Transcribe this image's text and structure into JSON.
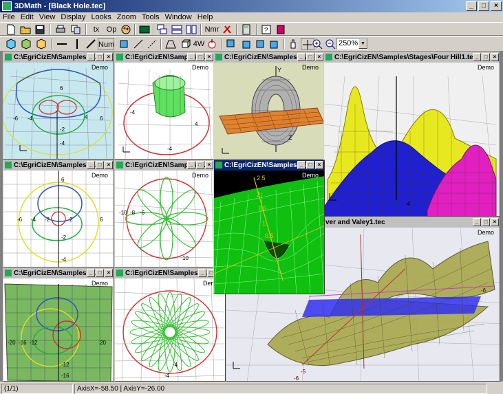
{
  "app": {
    "title": "3DMath - [Black Hole.tec]"
  },
  "window_buttons": {
    "minimize": "_",
    "maximize": "□",
    "close": "×"
  },
  "menu": [
    "File",
    "Edit",
    "View",
    "Display",
    "Looks",
    "Zoom",
    "Tools",
    "Window",
    "Help"
  ],
  "toolbar1": {
    "tx_label": "tx",
    "op_label": "Op",
    "nmr_label": "Nmr"
  },
  "toolbar2": {
    "num_label": "Num",
    "fourw_label": "4W",
    "zoom_value": "250%"
  },
  "windows": [
    {
      "title": "C:\\EgriCizEN\\Samples\\P...",
      "demo": "Demo"
    },
    {
      "title": "C:\\EgriCizEN\\Samples\\P...",
      "demo": "Demo"
    },
    {
      "title": "C:\\EgriCizEN\\Samples\\Av...",
      "demo": "Demo"
    },
    {
      "title": "C:\\EgriCizEN\\Samples\\Stages\\Four Hill1.tec",
      "demo": "Demo"
    },
    {
      "title": "C:\\EgriCizEN\\Samples\\P...",
      "demo": "Demo"
    },
    {
      "title": "C:\\EgriCizEN\\Samples\\P...",
      "demo": "Demo"
    },
    {
      "title": "C:\\EgriCizEN\\Samples\\As...",
      "demo": "Demo"
    },
    {
      "title": "ver and Valey1.tec",
      "demo": "Demo"
    },
    {
      "title": "C:\\EgriCizEN\\Samples\\P...",
      "demo": "Demo"
    },
    {
      "title": "C:\\EgriCizEN\\Samples\\P...",
      "demo": "Demo"
    }
  ],
  "status": {
    "page": "(1/1)",
    "axis": "AxisX=-58.50  |  AxisY=-26.00"
  },
  "colors": {
    "title_active": "#0a246a",
    "workspace": "#808080"
  }
}
